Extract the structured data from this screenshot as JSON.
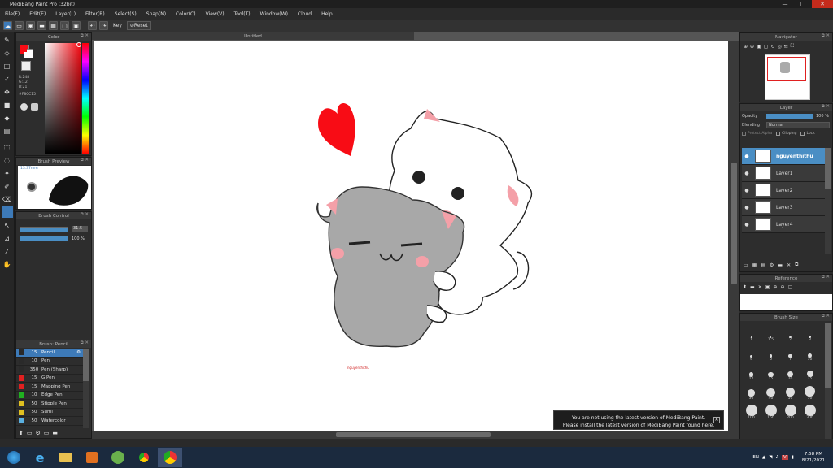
{
  "window": {
    "title": "MediBang Paint Pro (32bit)"
  },
  "menu": [
    "File(F)",
    "Edit(E)",
    "Layer(L)",
    "Filter(R)",
    "Select(S)",
    "Snap(N)",
    "Color(C)",
    "View(V)",
    "Tool(T)",
    "Window(W)",
    "Cloud",
    "Help"
  ],
  "toolbar": {
    "key_label": "Key",
    "reset_label": "Reset"
  },
  "canvas_tab": {
    "title": "Untitled"
  },
  "color_panel": {
    "title": "Color",
    "r": "R:248",
    "g": "G:12",
    "b": "B:21",
    "hex": "#F80C15",
    "primary": "#F80C15",
    "secondary": "#FFFFFF"
  },
  "brush_preview": {
    "title": "Brush Preview",
    "size": "13.37mm"
  },
  "brush_control": {
    "title": "Brush Control",
    "size_value": "31.5",
    "opacity_value": "100 %"
  },
  "brush_list": {
    "title": "Brush: Pencil",
    "items": [
      {
        "color": "#2a2a2a",
        "size": "15",
        "name": "Pencil",
        "selected": true
      },
      {
        "color": "#2a2a2a",
        "size": "10",
        "name": "Pen",
        "selected": false
      },
      {
        "color": "#2a2a2a",
        "size": "350",
        "name": "Pen (Sharp)",
        "selected": false
      },
      {
        "color": "#e02020",
        "size": "15",
        "name": "G Pen",
        "selected": false
      },
      {
        "color": "#e02020",
        "size": "15",
        "name": "Mapping Pen",
        "selected": false
      },
      {
        "color": "#20b020",
        "size": "10",
        "name": "Edge Pen",
        "selected": false
      },
      {
        "color": "#e0c020",
        "size": "50",
        "name": "Stipple Pen",
        "selected": false
      },
      {
        "color": "#e0c020",
        "size": "50",
        "name": "Sumi",
        "selected": false
      },
      {
        "color": "#5ab0e0",
        "size": "50",
        "name": "Watercolor",
        "selected": false
      }
    ]
  },
  "navigator": {
    "title": "Navigator"
  },
  "layer_panel": {
    "title": "Layer",
    "opacity_label": "Opacity",
    "opacity_value": "100 %",
    "blending_label": "Blending",
    "blending_value": "Normal",
    "protect_alpha": "Protect Alpha",
    "clipping": "Clipping",
    "lock": "Lock",
    "layers": [
      {
        "name": "nguyenthithu",
        "selected": true
      },
      {
        "name": "Layer1",
        "selected": false
      },
      {
        "name": "Layer2",
        "selected": false
      },
      {
        "name": "Layer3",
        "selected": false
      },
      {
        "name": "Layer4",
        "selected": false
      }
    ]
  },
  "reference": {
    "title": "Reference"
  },
  "brush_size": {
    "title": "Brush Size",
    "sizes": [
      "1",
      "1.5",
      "2",
      "3",
      "4",
      "5",
      "7",
      "10",
      "12",
      "15",
      "20",
      "25",
      "30",
      "40",
      "50",
      "70",
      "100",
      "150",
      "200",
      "300"
    ]
  },
  "canvas": {
    "signature": "nguyenthithu"
  },
  "notice": {
    "line1": "You are not using the latest version of MediBang Paint.",
    "line2": "Please install the latest version of MediBang Paint found here."
  },
  "taskbar": {
    "lang": "EN",
    "time": "7:58 PM",
    "date": "8/21/2021"
  }
}
